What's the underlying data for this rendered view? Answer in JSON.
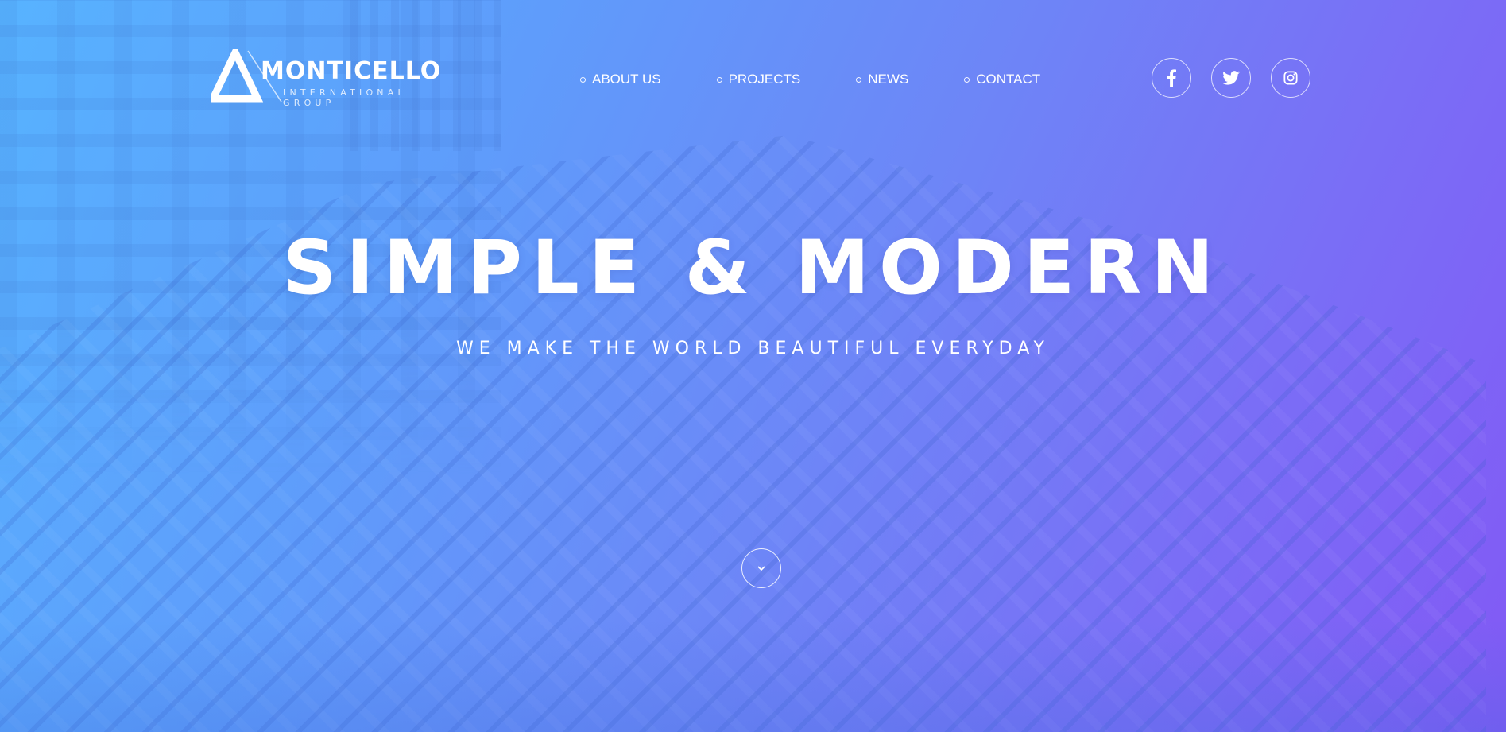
{
  "brand": {
    "name": "MONTICELLO",
    "tagline": "INTERNATIONAL GROUP"
  },
  "nav": {
    "items": [
      {
        "label": "ABOUT US"
      },
      {
        "label": "PROJECTS"
      },
      {
        "label": "NEWS"
      },
      {
        "label": "CONTACT"
      }
    ]
  },
  "social": {
    "items": [
      {
        "icon": "facebook-icon"
      },
      {
        "icon": "twitter-icon"
      },
      {
        "icon": "instagram-icon"
      }
    ]
  },
  "hero": {
    "headline": "SIMPLE & MODERN",
    "subheadline": "WE MAKE THE WORLD BEAUTIFUL EVERYDAY",
    "scroll_icon": "chevron-down-icon"
  },
  "colors": {
    "gradient_start": "#57b3ff",
    "gradient_end": "#8259f5",
    "text": "#ffffff"
  }
}
